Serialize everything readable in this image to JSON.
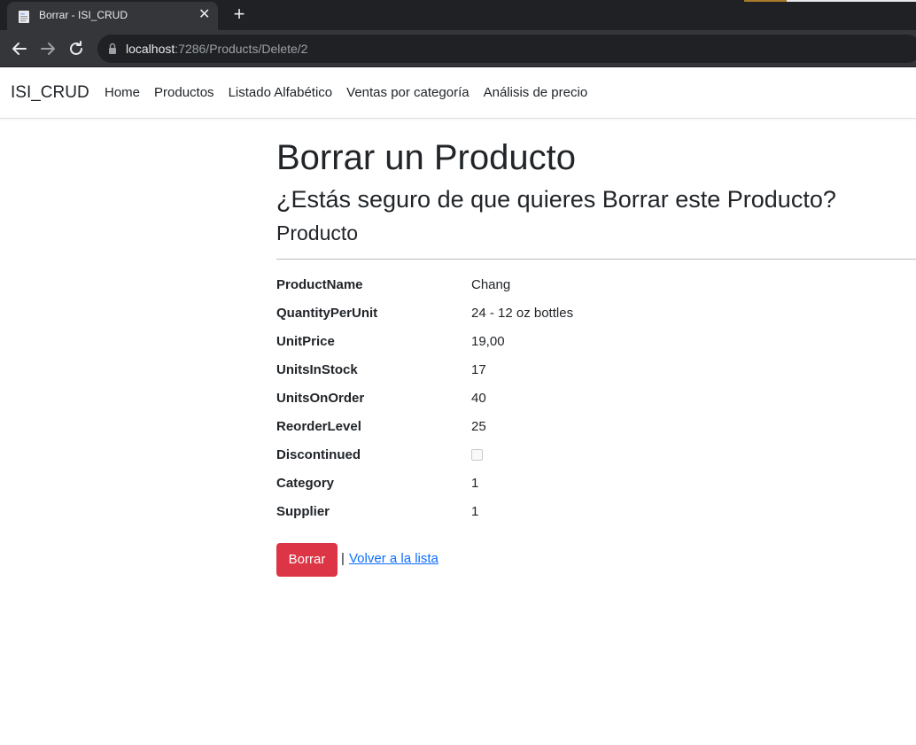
{
  "browser": {
    "tab_title": "Borrar - ISI_CRUD",
    "url_host": "localhost",
    "url_rest": ":7286/Products/Delete/2"
  },
  "navbar": {
    "brand": "ISI_CRUD",
    "links": [
      {
        "label": "Home"
      },
      {
        "label": "Productos"
      },
      {
        "label": "Listado Alfabético"
      },
      {
        "label": "Ventas por categoría"
      },
      {
        "label": "Análisis de precio"
      }
    ]
  },
  "page": {
    "title": "Borrar un Producto",
    "question": "¿Estás seguro de que quieres Borrar este Producto?",
    "section": "Producto"
  },
  "details": [
    {
      "label": "ProductName",
      "value": "Chang"
    },
    {
      "label": "QuantityPerUnit",
      "value": "24 - 12 oz bottles"
    },
    {
      "label": "UnitPrice",
      "value": "19,00"
    },
    {
      "label": "UnitsInStock",
      "value": "17"
    },
    {
      "label": "UnitsOnOrder",
      "value": "40"
    },
    {
      "label": "ReorderLevel",
      "value": "25"
    },
    {
      "label": "Discontinued",
      "value": ""
    },
    {
      "label": "Category",
      "value": "1"
    },
    {
      "label": "Supplier",
      "value": "1"
    }
  ],
  "discontinued_checked": false,
  "actions": {
    "delete_label": "Borrar",
    "separator": "|",
    "back_label": "Volver a la lista"
  },
  "colors": {
    "danger": "#dc3545",
    "link": "#0d6efd"
  }
}
